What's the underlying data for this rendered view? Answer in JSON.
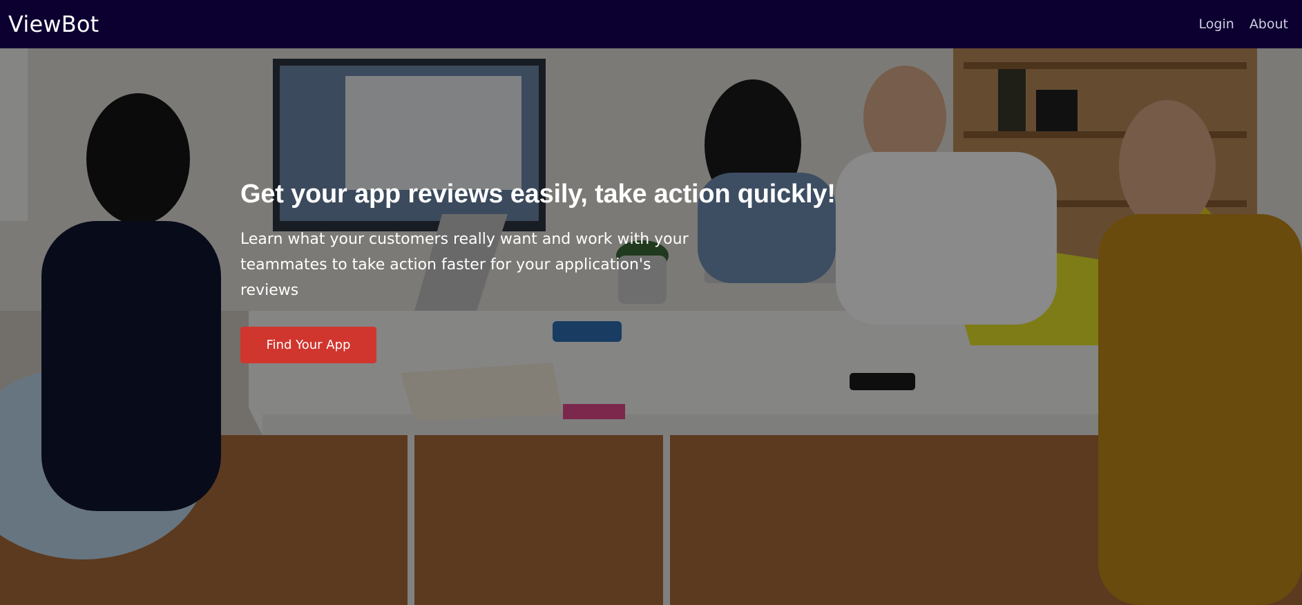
{
  "navbar": {
    "brand": "ViewBot",
    "links": [
      {
        "label": "Login"
      },
      {
        "label": "About"
      }
    ],
    "background_color": "#0c0030"
  },
  "hero": {
    "title": "Get your app reviews easily, take action quickly!",
    "subtitle": "Learn what your customers really want and work with your teammates to take action faster for your application's reviews",
    "cta_label": "Find Your App",
    "cta_color": "#d0362e",
    "background_image": "office-team-meeting-photo"
  }
}
